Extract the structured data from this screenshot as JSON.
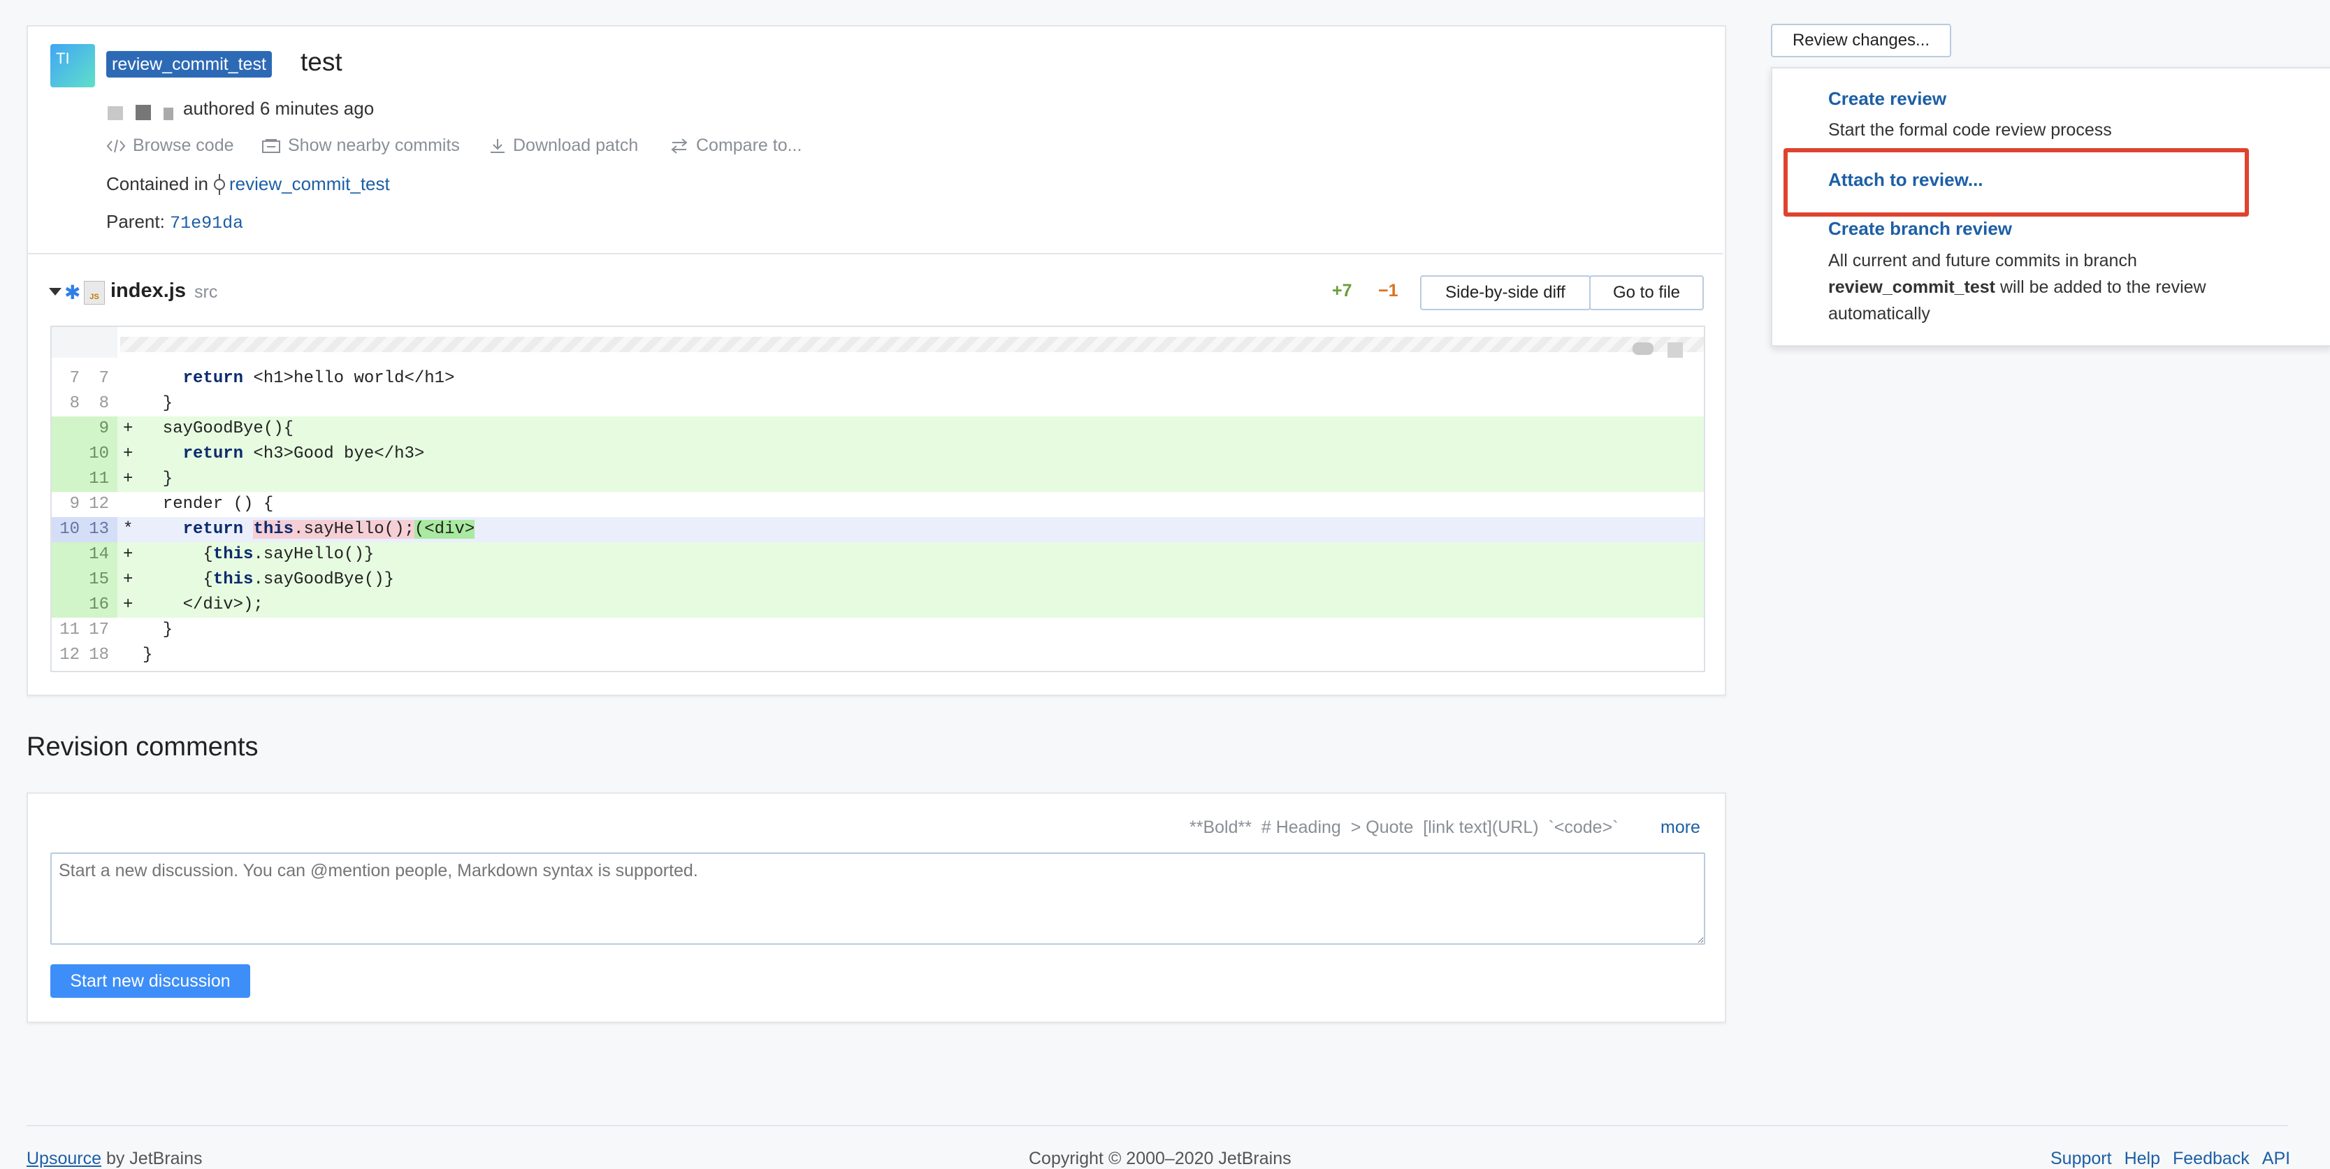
{
  "commit": {
    "avatar_initials": "TI",
    "branch_tag": "review_commit_test",
    "title": "test",
    "authored_text": "authored 6 minutes ago",
    "actions": [
      {
        "label": "Browse code",
        "icon": "code-icon"
      },
      {
        "label": "Show nearby commits",
        "icon": "commits-icon"
      },
      {
        "label": "Download patch",
        "icon": "download-icon"
      },
      {
        "label": "Compare to...",
        "icon": "compare-icon"
      }
    ],
    "contained_label": "Contained in",
    "contained_branch": "review_commit_test",
    "parent_label": "Parent:",
    "parent_hash": "71e91da"
  },
  "file": {
    "name": "index.js",
    "dir": "src",
    "additions": "+7",
    "deletions": "−1",
    "side_by_side": "Side-by-side diff",
    "go_to_file": "Go to file"
  },
  "diff": [
    {
      "old": "7",
      "new": "7",
      "sign": "",
      "code": "    return <h1>hello world</h1>",
      "type": "ctx"
    },
    {
      "old": "8",
      "new": "8",
      "sign": "",
      "code": "  }",
      "type": "ctx"
    },
    {
      "old": "",
      "new": "9",
      "sign": "+",
      "code": "  sayGoodBye(){",
      "type": "add"
    },
    {
      "old": "",
      "new": "10",
      "sign": "+",
      "code": "    return <h3>Good bye</h3>",
      "type": "add"
    },
    {
      "old": "",
      "new": "11",
      "sign": "+",
      "code": "  }",
      "type": "add"
    },
    {
      "old": "9",
      "new": "12",
      "sign": "",
      "code": "  render () {",
      "type": "ctx"
    },
    {
      "old": "10",
      "new": "13",
      "sign": "*",
      "code": "    return this.sayHello();(<div>",
      "type": "mod"
    },
    {
      "old": "",
      "new": "14",
      "sign": "+",
      "code": "      {this.sayHello()}",
      "type": "add"
    },
    {
      "old": "",
      "new": "15",
      "sign": "+",
      "code": "      {this.sayGoodBye()}",
      "type": "add"
    },
    {
      "old": "",
      "new": "16",
      "sign": "+",
      "code": "    </div>);",
      "type": "add"
    },
    {
      "old": "11",
      "new": "17",
      "sign": "",
      "code": "  }",
      "type": "ctx"
    },
    {
      "old": "12",
      "new": "18",
      "sign": "",
      "code": "}",
      "type": "ctx"
    }
  ],
  "comments": {
    "heading": "Revision comments",
    "hints": "**Bold**  # Heading  > Quote  [link text](URL)  `<code>`",
    "more": "more",
    "placeholder": "Start a new discussion. You can @mention people, Markdown syntax is supported.",
    "submit": "Start new discussion"
  },
  "review": {
    "button": "Review changes...",
    "menu": [
      {
        "label": "Create review",
        "desc": "Start the formal code review process"
      },
      {
        "label": "Attach to review...",
        "desc": ""
      },
      {
        "label": "Create branch review",
        "desc_pre": "All current and future commits in branch",
        "desc_bold": "review_commit_test",
        "desc_post": "will be added to the review automatically"
      }
    ]
  },
  "footer": {
    "left_link": "Upsource",
    "left_text": "by JetBrains",
    "center": "Copyright © 2000–2020 JetBrains",
    "links": [
      "Support",
      "Help",
      "Feedback",
      "API"
    ]
  },
  "colors": {
    "accent": "#1c5fa6",
    "tag_bg": "#2d6ab6",
    "highlight_box": "#e0432d",
    "added": "#e6fbe0",
    "primary_button": "#3d8ef8"
  }
}
